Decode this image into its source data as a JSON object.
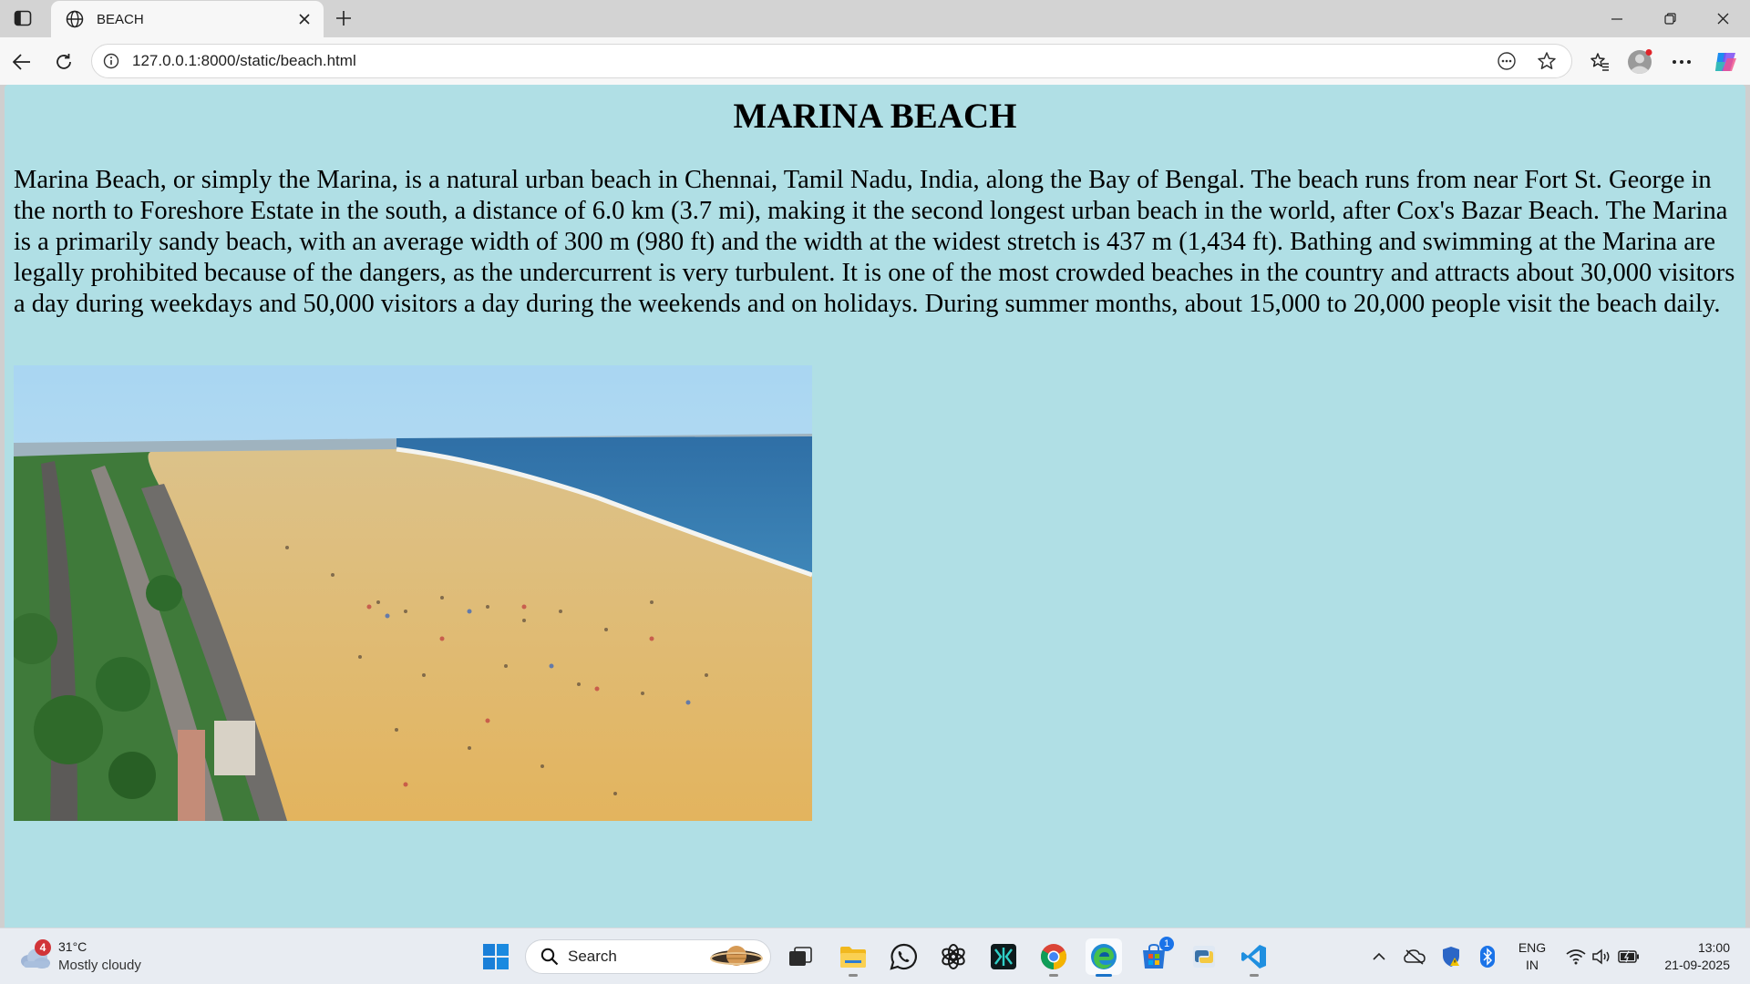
{
  "browser": {
    "tab_title": "BEACH",
    "url": "127.0.0.1:8000/static/beach.html"
  },
  "page": {
    "heading": "MARINA BEACH",
    "paragraph": "Marina Beach, or simply the Marina, is a natural urban beach in Chennai, Tamil Nadu, India, along the Bay of Bengal. The beach runs from near Fort St. George in the north to Foreshore Estate in the south, a distance of 6.0 km (3.7 mi), making it the second longest urban beach in the world, after Cox's Bazar Beach. The Marina is a primarily sandy beach, with an average width of 300 m (980 ft) and the width at the widest stretch is 437 m (1,434 ft). Bathing and swimming at the Marina are legally prohibited because of the dangers, as the undercurrent is very turbulent. It is one of the most crowded beaches in the country and attracts about 30,000 visitors a day during weekdays and 50,000 visitors a day during the weekends and on holidays. During summer months, about 15,000 to 20,000 people visit the beach daily.",
    "background_color": "#b0dfe5"
  },
  "taskbar": {
    "weather": {
      "badge": "4",
      "temperature": "31°C",
      "condition": "Mostly cloudy"
    },
    "search_label": "Search",
    "store_badge": "1",
    "language": {
      "line1": "ENG",
      "line2": "IN"
    },
    "clock": {
      "time": "13:00",
      "date": "21-09-2025"
    }
  }
}
